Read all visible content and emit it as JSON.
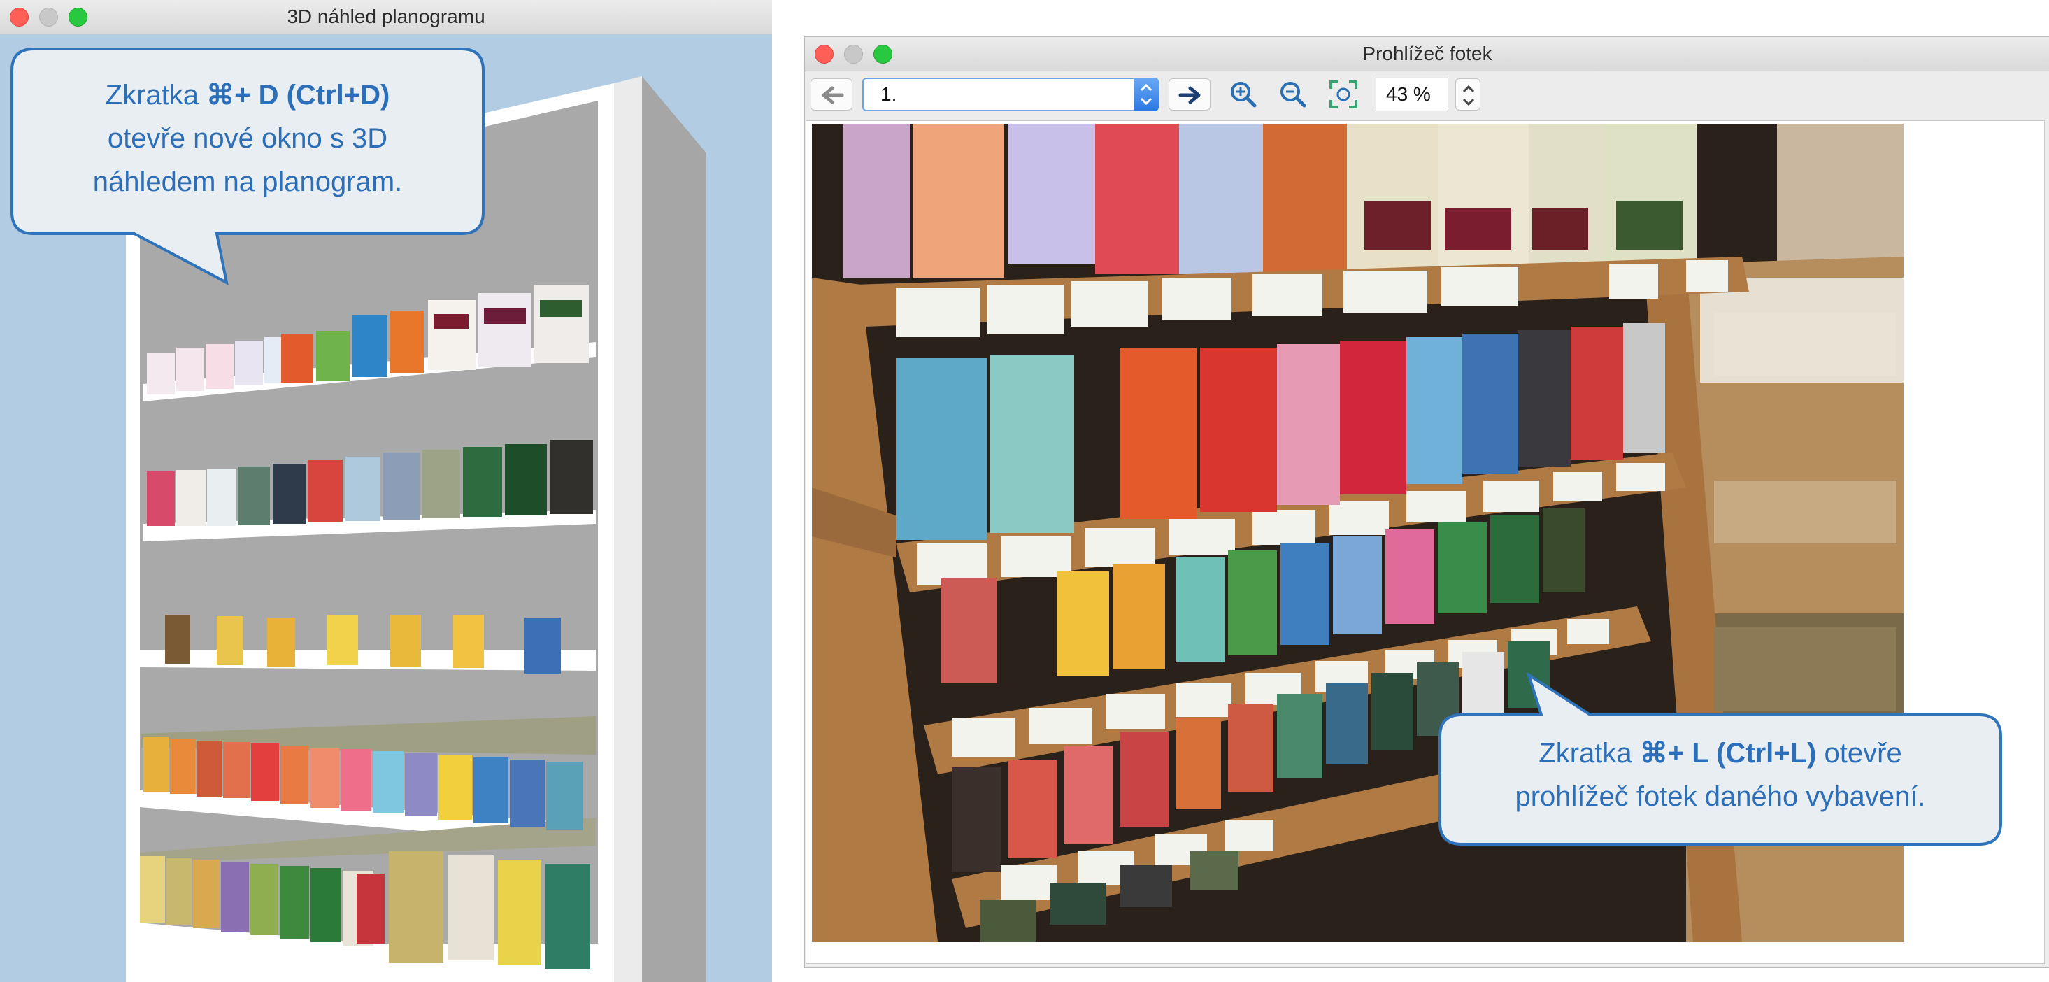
{
  "window_3d": {
    "title": "3D náhled planogramu",
    "callout": {
      "line1_prefix": "Zkratka ",
      "line1_key": "⌘+ D (Ctrl+D)",
      "line2": "otevře nové okno s 3D",
      "line3": "náhledem na planogram."
    }
  },
  "window_photo": {
    "title": "Prohlížeč fotek",
    "toolbar": {
      "back_icon": "arrow-left-icon",
      "photo_select_value": "1.",
      "forward_icon": "arrow-right-icon",
      "zoom_in_icon": "zoom-in-icon",
      "zoom_out_icon": "zoom-out-icon",
      "fit_icon": "fit-to-window-icon",
      "zoom_value": "43 %"
    },
    "callout": {
      "line1_prefix": "Zkratka ",
      "line1_key": "⌘+ L (Ctrl+L)",
      "line1_suffix": " otevře",
      "line2": "prohlížeč fotek daného vybavení."
    }
  },
  "colors": {
    "sky": "#b2cde3",
    "callout_fill": "#e9eef3",
    "callout_border": "#2f73ba",
    "callout_text": "#2c6fb8",
    "wood": "#b07a45",
    "select_accent": "#2b78e4"
  }
}
